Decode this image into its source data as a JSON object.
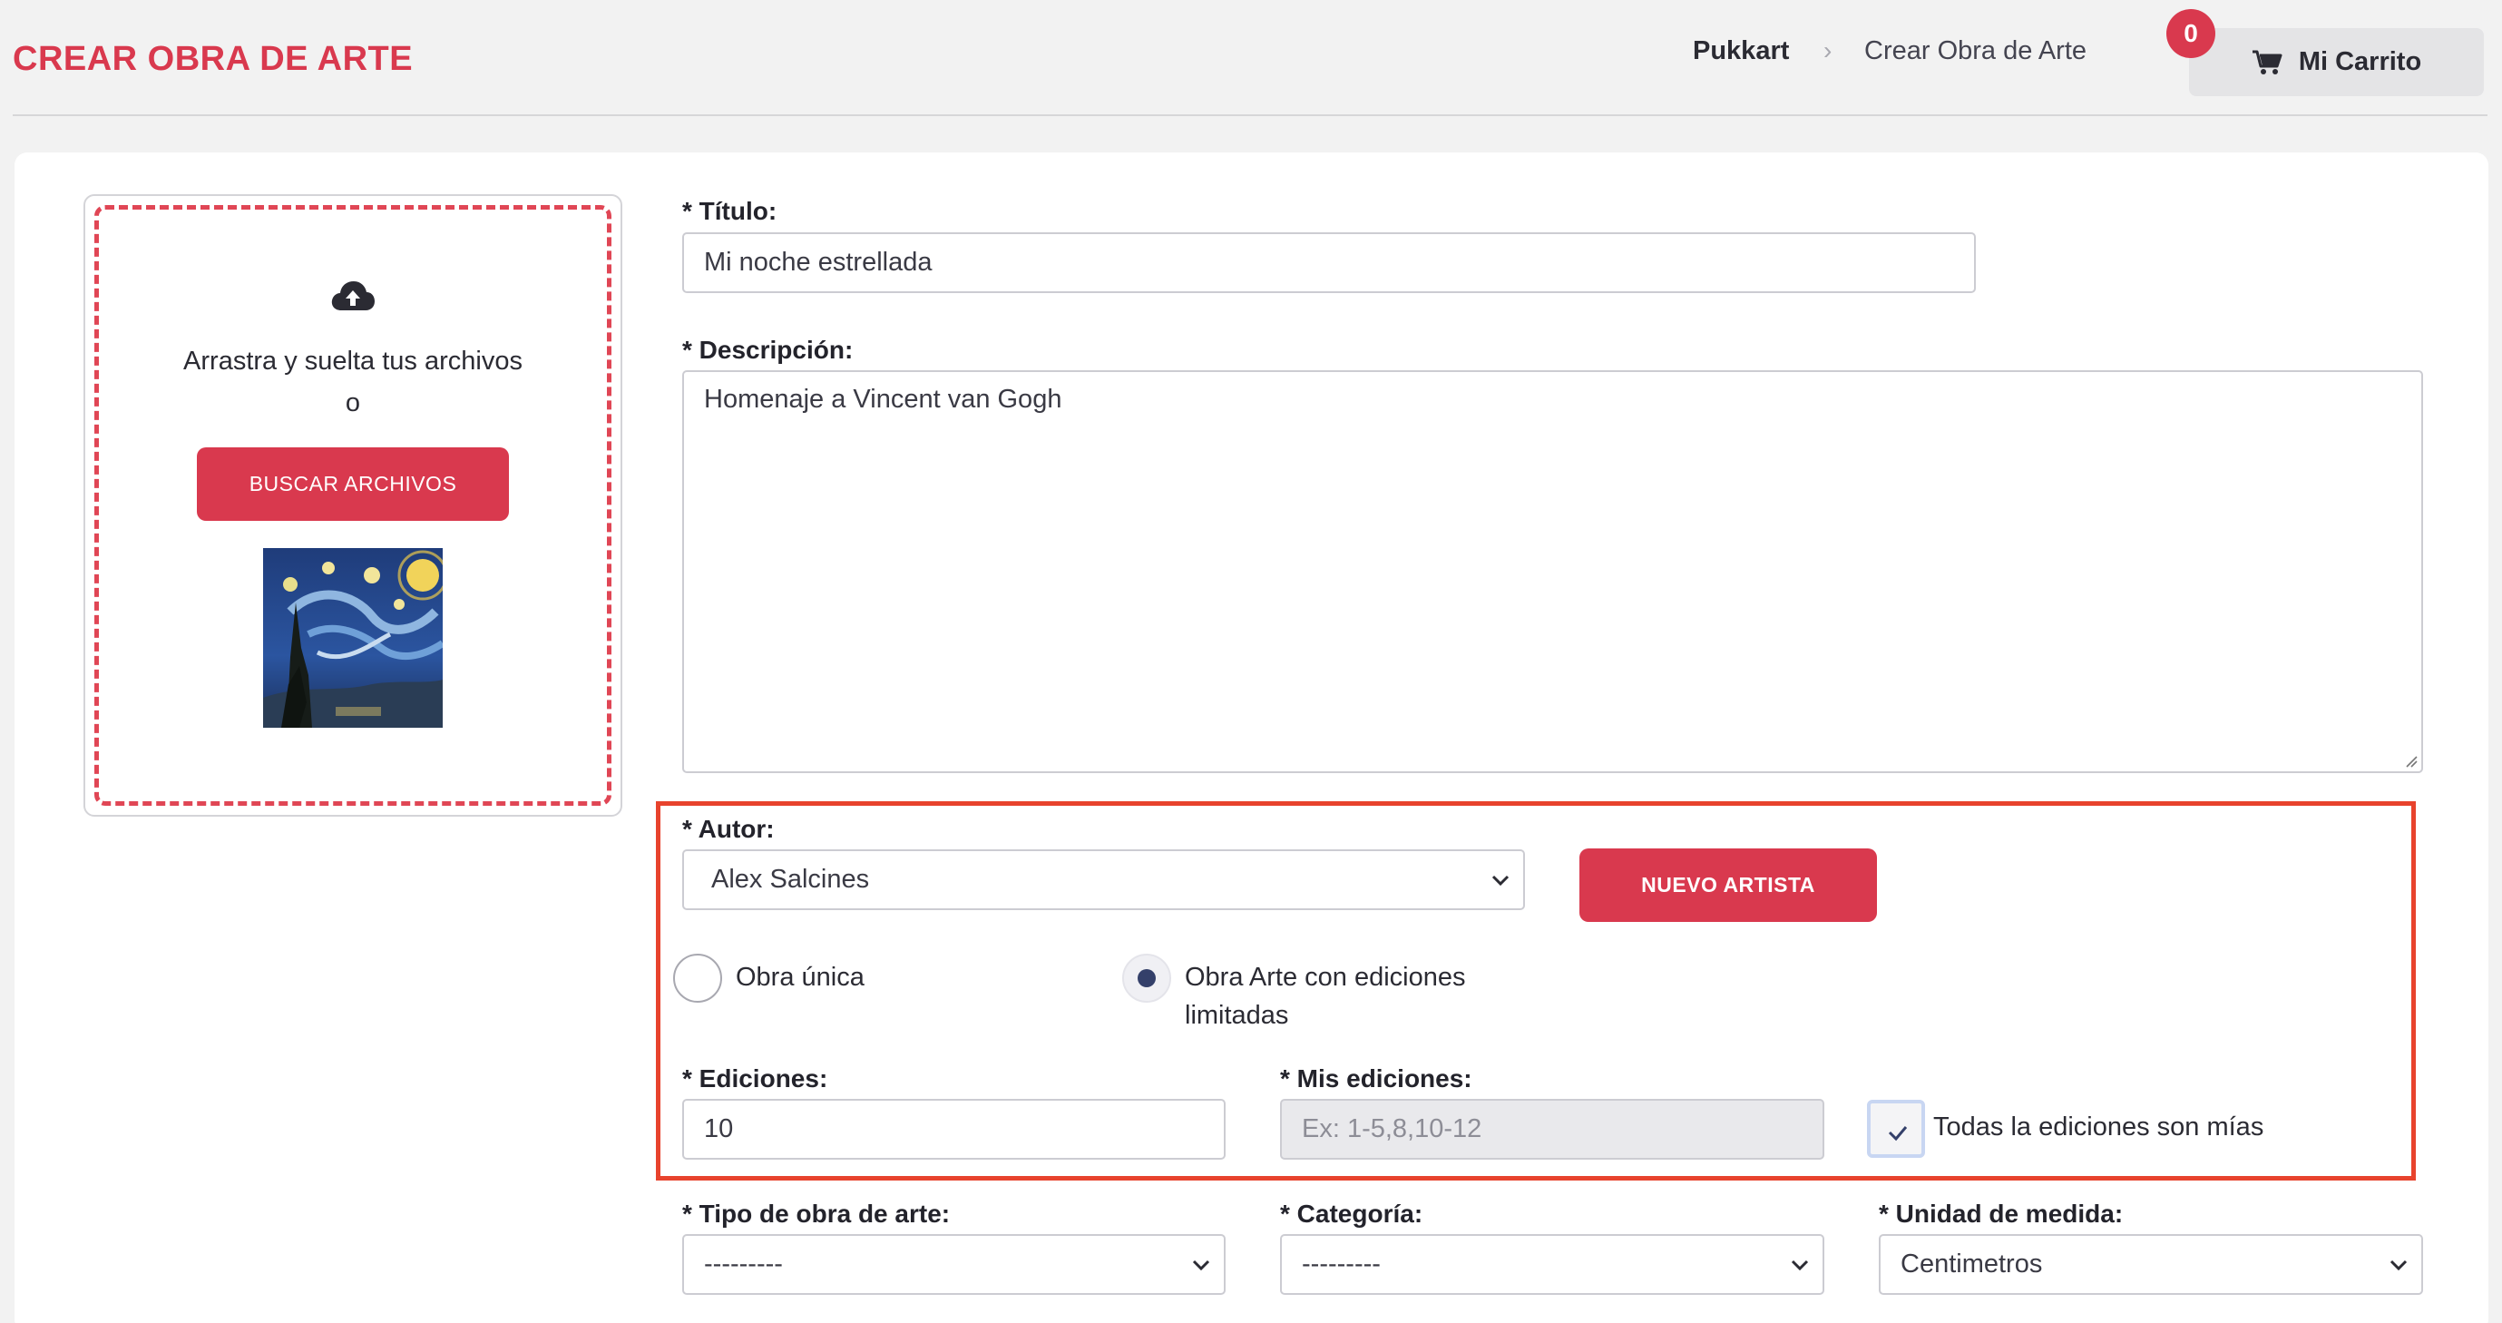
{
  "header": {
    "title": "CREAR OBRA DE ARTE",
    "breadcrumb_root": "Pukkart",
    "breadcrumb_separator": "›",
    "breadcrumb_current": "Crear Obra de Arte",
    "cart_label": "Mi Carrito",
    "cart_count": "0",
    "cart_icon": "shopping-cart-icon"
  },
  "upload": {
    "icon": "cloud-upload-icon",
    "drag_text": "Arrastra y suelta tus archivos",
    "or_text": "o",
    "browse_label": "BUSCAR ARCHIVOS"
  },
  "form": {
    "title_label": "* Título:",
    "title_value": "Mi noche estrellada",
    "description_label": "* Descripción:",
    "description_value": "Homenaje a Vincent van Gogh",
    "author_label": "* Autor:",
    "author_value": "Alex Salcines",
    "new_artist_label": "NUEVO ARTISTA",
    "radio_unique_label": "Obra única",
    "radio_limited_label_line1": "Obra Arte con ediciones",
    "radio_limited_label_line2": "limitadas",
    "editions_label": "* Ediciones:",
    "editions_value": "10",
    "my_editions_label": "* Mis ediciones:",
    "my_editions_placeholder": "Ex: 1-5,8,10-12",
    "all_editions_label": "Todas la ediciones son mías",
    "all_editions_checked": true,
    "art_type_label": "* Tipo de obra de arte:",
    "art_type_value": "---------",
    "category_label": "* Categoría:",
    "category_value": "---------",
    "unit_label": "* Unidad de medida:",
    "unit_value": "Centimetros"
  },
  "colors": {
    "accent": "#d9394e",
    "highlight_border": "#e8432d"
  }
}
